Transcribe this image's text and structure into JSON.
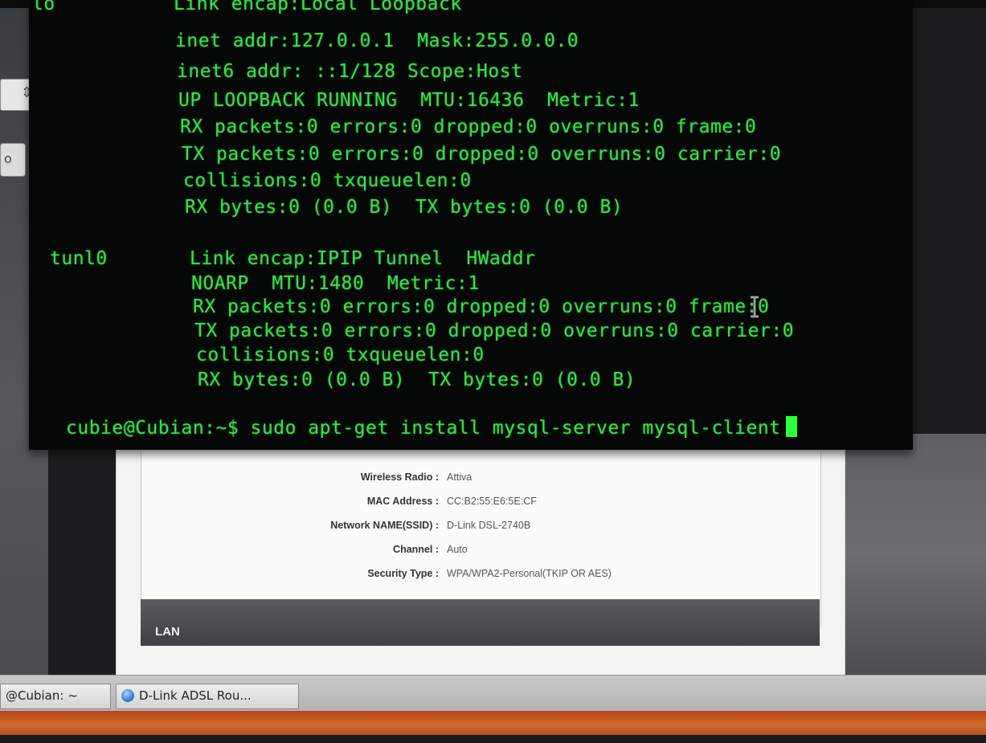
{
  "terminal": {
    "lines": [
      "Link encap:Local Loopback",
      "inet addr:127.0.0.1  Mask:255.0.0.0",
      "inet6 addr: ::1/128 Scope:Host",
      "UP LOOPBACK RUNNING  MTU:16436  Metric:1",
      "RX packets:0 errors:0 dropped:0 overruns:0 frame:0",
      "TX packets:0 errors:0 dropped:0 overruns:0 carrier:0",
      "collisions:0 txqueuelen:0",
      "RX bytes:0 (0.0 B)  TX bytes:0 (0.0 B)"
    ],
    "lo_label": "lo",
    "tunl_label": "tunl0",
    "tunl_lines": [
      "Link encap:IPIP Tunnel  HWaddr",
      "NOARP  MTU:1480  Metric:1",
      "RX packets:0 errors:0 dropped:0 overruns:0 frame:0",
      "TX packets:0 errors:0 dropped:0 overruns:0 carrier:0",
      "collisions:0 txqueuelen:0",
      "RX bytes:0 (0.0 B)  TX bytes:0 (0.0 B)"
    ],
    "prompt": "cubie@Cubian:~$ sudo apt-get install mysql-server mysql-client"
  },
  "router": {
    "rows": [
      {
        "label": "Wireless Radio :",
        "value": "Attiva"
      },
      {
        "label": "MAC Address :",
        "value": "CC:B2:55:E6:5E:CF"
      },
      {
        "label": "Network NAME(SSID) :",
        "value": "D-Link DSL-2740B"
      },
      {
        "label": "Channel :",
        "value": "Auto"
      },
      {
        "label": "Security Type :",
        "value": "WPA/WPA2-Personal(TKIP OR AES)"
      }
    ],
    "lan_header": "LAN"
  },
  "taskbar": {
    "items": [
      {
        "label": "@Cubian: ~"
      },
      {
        "label": "D-Link ADSL Rou..."
      }
    ]
  },
  "colors": {
    "terminal_text": "#39e04a",
    "terminal_bg": "#050806",
    "cursor": "#2bff3c"
  },
  "icons": {
    "text_cursor": "i-beam-cursor-icon",
    "browser": "browser-globe-icon"
  }
}
